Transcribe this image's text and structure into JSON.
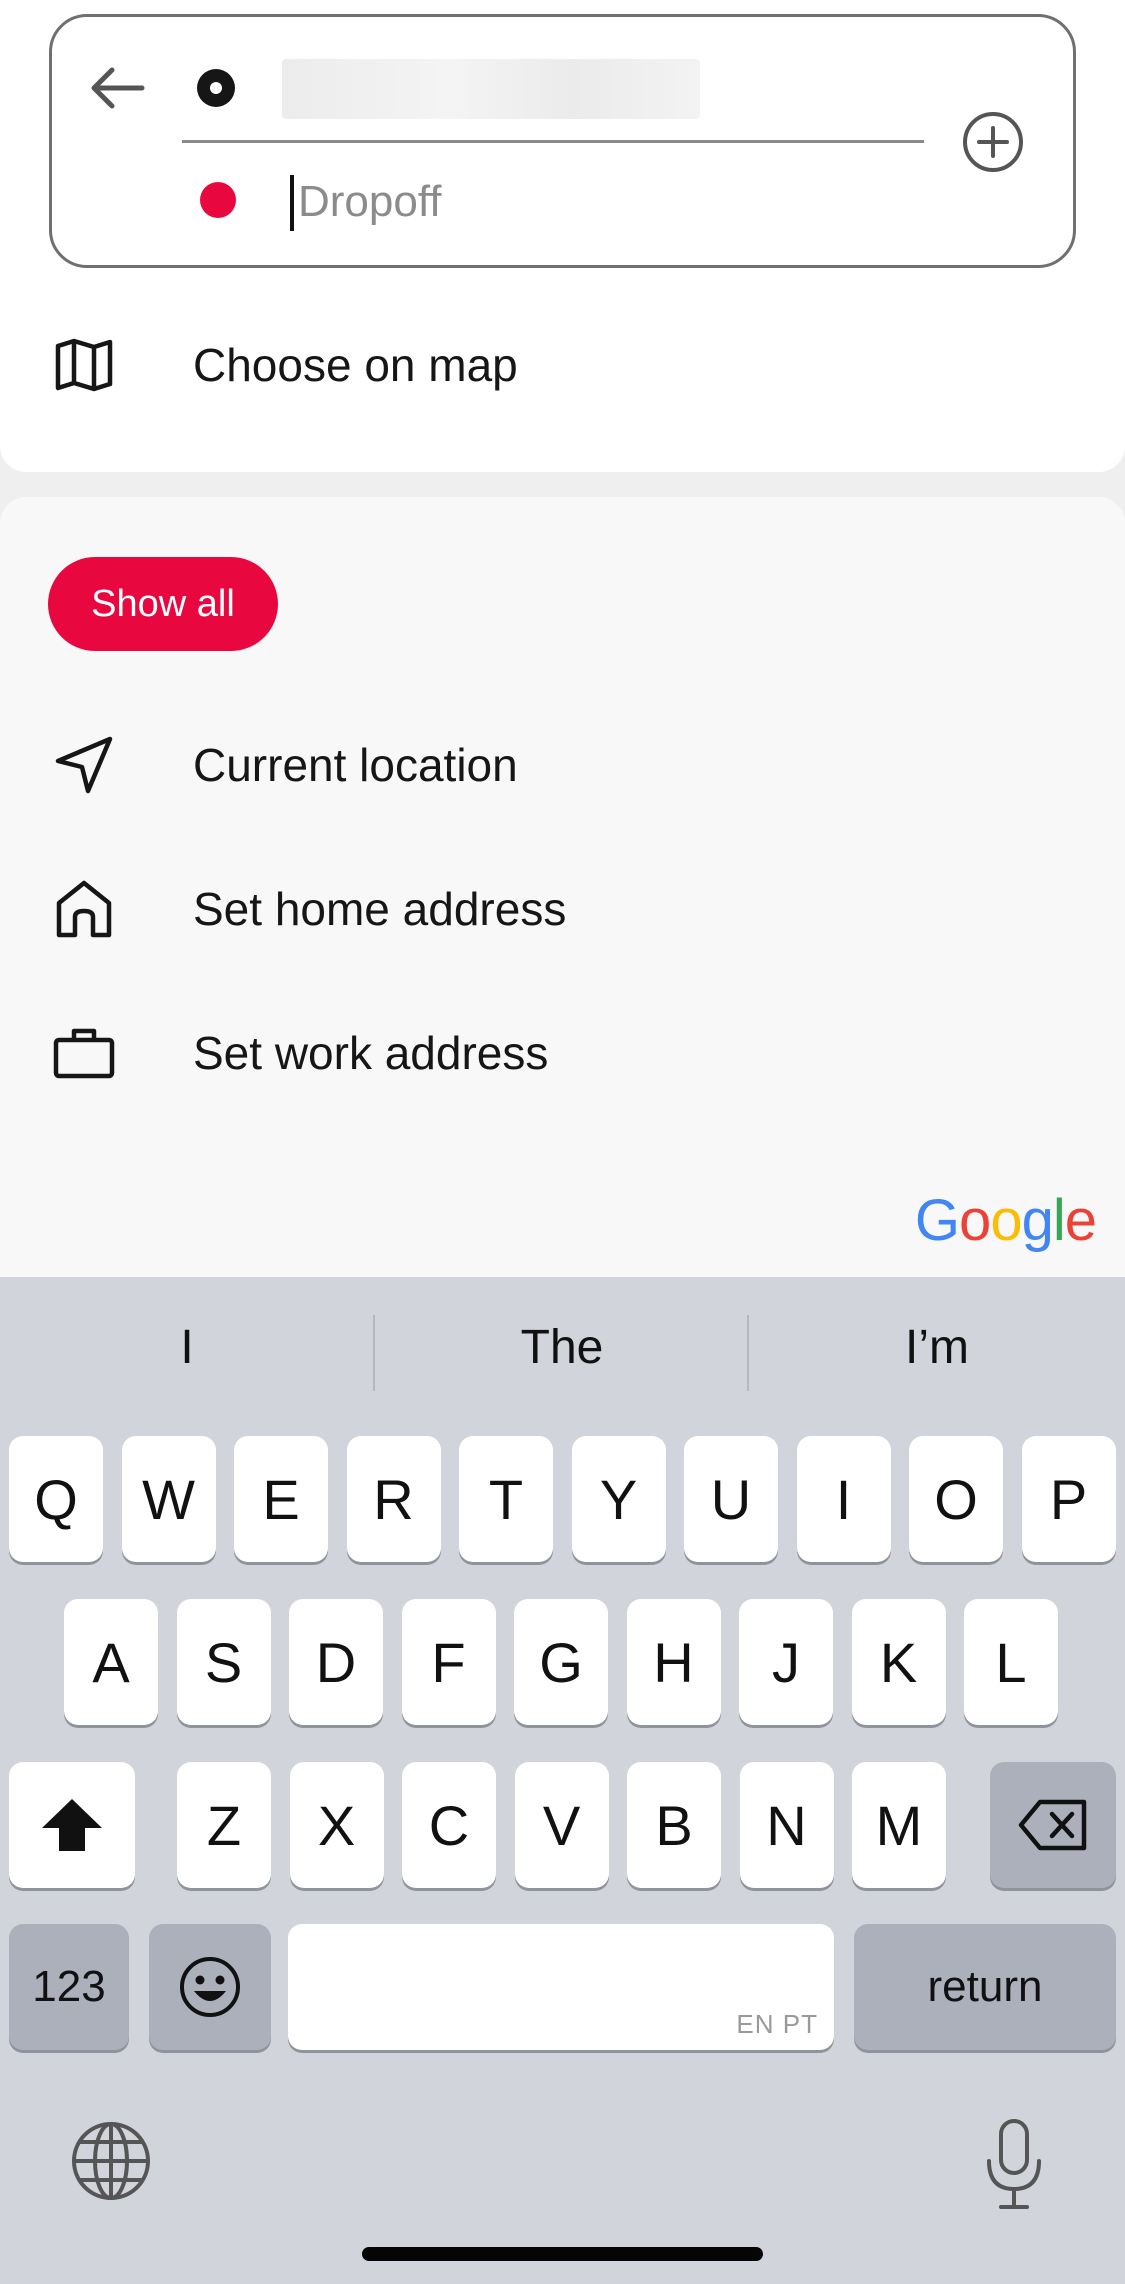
{
  "route": {
    "pickup_value": "",
    "dropoff_placeholder": "Dropoff",
    "dropoff_value": ""
  },
  "actions": {
    "choose_on_map": "Choose on map"
  },
  "places": {
    "show_all": "Show all",
    "items": [
      {
        "icon": "navigation-arrow-icon",
        "label": "Current location"
      },
      {
        "icon": "home-icon",
        "label": "Set home address"
      },
      {
        "icon": "briefcase-icon",
        "label": "Set work address"
      }
    ],
    "attribution": "Google"
  },
  "keyboard": {
    "suggestions": [
      "I",
      "The",
      "I’m"
    ],
    "row1": [
      "Q",
      "W",
      "E",
      "R",
      "T",
      "Y",
      "U",
      "I",
      "O",
      "P"
    ],
    "row2": [
      "A",
      "S",
      "D",
      "F",
      "G",
      "H",
      "J",
      "K",
      "L"
    ],
    "row3": [
      "Z",
      "X",
      "C",
      "V",
      "B",
      "N",
      "M"
    ],
    "numbers_key": "123",
    "return_key": "return",
    "space_languages": "EN PT"
  },
  "colors": {
    "accent": "#e8073f",
    "keyboard_bg": "#d1d4da",
    "google_blue": "#4285F4",
    "google_red": "#EA4335",
    "google_yellow": "#FBBC05",
    "google_green": "#34A853"
  }
}
